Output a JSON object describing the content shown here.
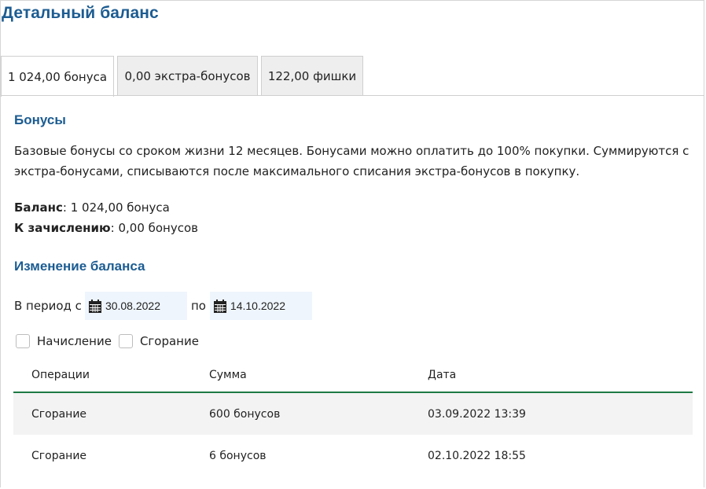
{
  "page": {
    "title": "Детальный баланс"
  },
  "tabs": [
    {
      "label": "1 024,00 бонуса",
      "active": true
    },
    {
      "label": "0,00 экстра-бонусов",
      "active": false
    },
    {
      "label": "122,00 фишки",
      "active": false
    }
  ],
  "bonuses": {
    "title": "Бонусы",
    "description": "Базовые бонусы со сроком жизни 12 месяцев. Бонусами можно оплатить до 100% покупки. Суммируются с экстра-бонусами, списываются после максимального списания экстра-бонусов в покупку.",
    "balance_label": "Баланс",
    "balance_value": ": 1 024,00 бонуса",
    "accrual_label": "К зачислению",
    "accrual_value": ": 0,00 бонусов"
  },
  "history": {
    "title": "Изменение баланса",
    "period_label": "В период с",
    "to_label": "по",
    "date_from": "30.08.2022",
    "date_to": "14.10.2022",
    "filters": [
      {
        "label": "Начисление",
        "checked": false
      },
      {
        "label": "Сгорание",
        "checked": false
      }
    ],
    "columns": [
      "Операции",
      "Сумма",
      "Дата"
    ],
    "rows": [
      [
        "Сгорание",
        "600 бонусов",
        "03.09.2022 13:39"
      ],
      [
        "Сгорание",
        "6 бонусов",
        "02.10.2022 18:55"
      ]
    ]
  },
  "colors": {
    "accent": "#1c5c92",
    "table_rule": "#1f7a44",
    "date_bg": "#eef5fc"
  },
  "icons": {
    "date_picker": "calendar-icon"
  }
}
